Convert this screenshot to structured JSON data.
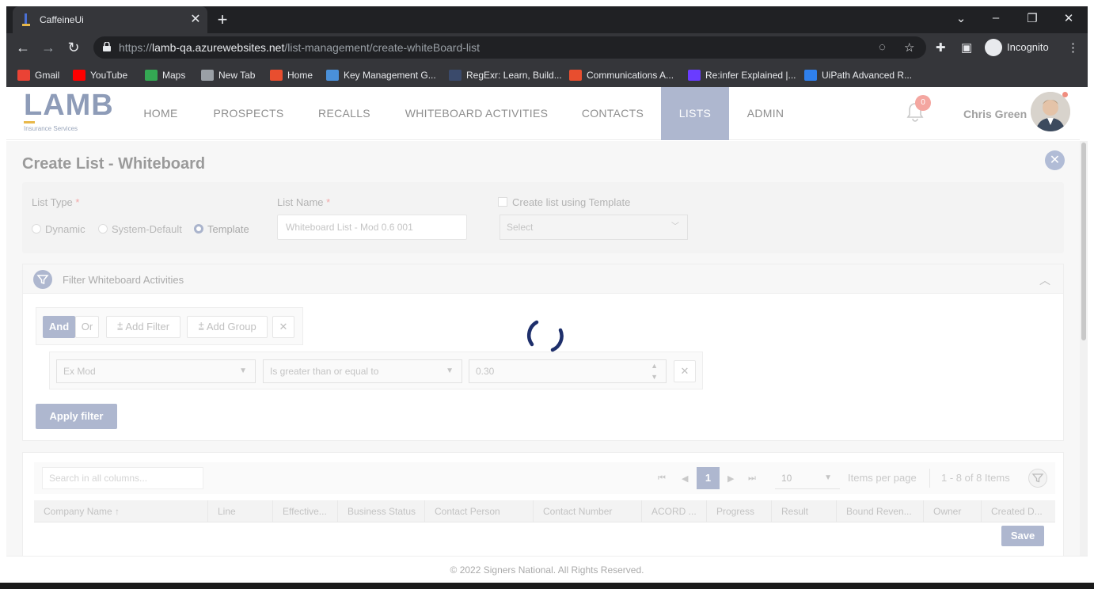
{
  "browser": {
    "tab_title": "CaffeineUi",
    "url_prefix": "https://",
    "url_host": "lamb-qa.azurewebsites.net",
    "url_path": "/list-management/create-whiteBoard-list",
    "profile_label": "Incognito",
    "bookmarks": [
      {
        "label": "Gmail",
        "color": "#ea4335"
      },
      {
        "label": "YouTube",
        "color": "#ff0000"
      },
      {
        "label": "Maps",
        "color": "#34a853"
      },
      {
        "label": "New Tab",
        "color": "#9aa0a6"
      },
      {
        "label": "Home",
        "color": "#e84e2f"
      },
      {
        "label": "Key Management G...",
        "color": "#4a90d9"
      },
      {
        "label": "RegExr: Learn, Build...",
        "color": "#3a4a6b"
      },
      {
        "label": "Communications A...",
        "color": "#e84e2f"
      },
      {
        "label": "Re:infer Explained |...",
        "color": "#6a3cff"
      },
      {
        "label": "UiPath Advanced R...",
        "color": "#2f80ed"
      }
    ]
  },
  "app": {
    "logo_text": "LAMB",
    "logo_subtext": "Insurance Services",
    "nav": [
      "HOME",
      "PROSPECTS",
      "RECALLS",
      "WHITEBOARD ACTIVITIES",
      "CONTACTS",
      "LISTS",
      "ADMIN"
    ],
    "active_nav": "LISTS",
    "notification_count": "0",
    "user_name": "Chris Green",
    "accent_color": "#aeb7cf"
  },
  "form": {
    "title": "Create List - Whiteboard",
    "list_type_label": "List Type",
    "required_mark": "*",
    "list_types": [
      "Dynamic",
      "System-Default",
      "Template"
    ],
    "selected_list_type": "Template",
    "list_name_label": "List Name",
    "list_name_value": "Whiteboard List - Mod  0.6 001",
    "template_checkbox_label": "Create list using Template",
    "template_select_placeholder": "Select"
  },
  "filter": {
    "title": "Filter Whiteboard Activities",
    "and_label": "And",
    "or_label": "Or",
    "add_filter_label": "Add Filter",
    "add_group_label": "Add Group",
    "field_value": "Ex Mod",
    "operator_value": "Is greater than or equal to",
    "numeric_value": "0.30",
    "apply_label": "Apply filter"
  },
  "grid": {
    "search_placeholder": "Search in all columns...",
    "current_page": "1",
    "page_size": "10",
    "items_per_page_label": "Items per page",
    "range_label": "1 - 8 of 8 Items",
    "columns": [
      "Company Name ↑",
      "Line",
      "Effective...",
      "Business Status",
      "Contact Person",
      "Contact Number",
      "ACORD ...",
      "Progress",
      "Result",
      "Bound Reven...",
      "Owner",
      "Created D..."
    ],
    "save_label": "Save"
  },
  "footer": {
    "text": "© 2022 Signers National. All Rights Reserved."
  }
}
